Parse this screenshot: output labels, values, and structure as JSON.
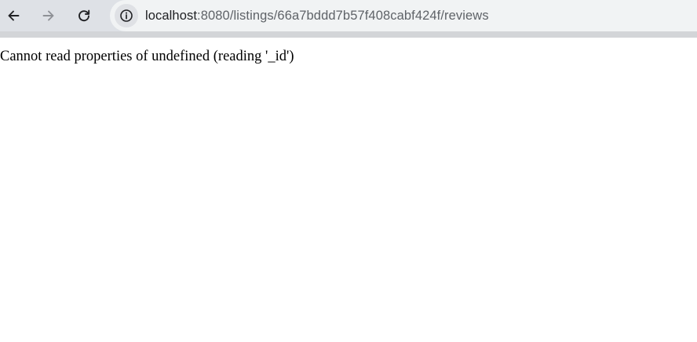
{
  "browser": {
    "nav": {
      "back_icon": "arrow-left-icon",
      "forward_icon": "arrow-right-icon",
      "reload_icon": "reload-icon"
    },
    "omnibox": {
      "site_info_icon": "info-icon",
      "url_host": "localhost",
      "url_path": ":8080/listings/66a7bddd7b57f408cabf424f/reviews"
    }
  },
  "page": {
    "error_message": "Cannot read properties of undefined (reading '_id')"
  },
  "colors": {
    "toolbar_bg": "#dee1e6",
    "omnibox_bg": "#f1f3f4",
    "page_bg": "#ffffff",
    "url_host": "#202124",
    "url_path": "#5f6368"
  }
}
